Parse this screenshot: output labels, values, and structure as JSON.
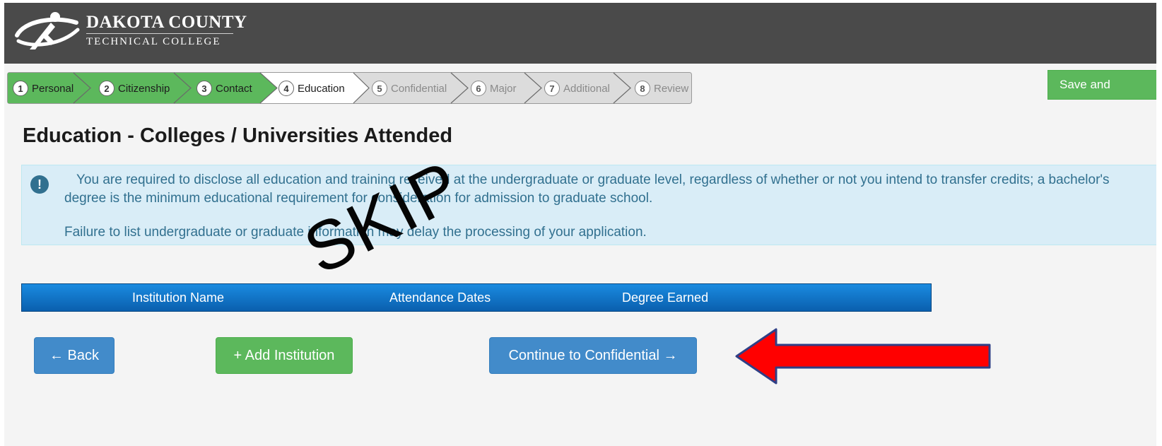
{
  "header": {
    "logo_line1": "DAKOTA COUNTY",
    "logo_line2": "TECHNICAL COLLEGE"
  },
  "steps": [
    {
      "num": "1",
      "label": "Personal",
      "state": "done"
    },
    {
      "num": "2",
      "label": "Citizenship",
      "state": "done"
    },
    {
      "num": "3",
      "label": "Contact",
      "state": "done"
    },
    {
      "num": "4",
      "label": "Education",
      "state": "current"
    },
    {
      "num": "5",
      "label": "Confidential",
      "state": "future"
    },
    {
      "num": "6",
      "label": "Major",
      "state": "future"
    },
    {
      "num": "7",
      "label": "Additional",
      "state": "future"
    },
    {
      "num": "8",
      "label": "Review",
      "state": "future"
    }
  ],
  "save_button": "Save and",
  "page_title": "Education - Colleges / Universities Attended",
  "alert": {
    "icon": "exclamation-circle-icon",
    "text1": "You are required to disclose all education and training received at the undergraduate or graduate level, regardless of whether or not you intend to transfer credits; a bachelor's degree is the minimum educational requirement for consideration for admission to graduate school.",
    "text2": "Failure to list undergraduate or graduate information may delay the processing of your application."
  },
  "table": {
    "columns": [
      "Institution Name",
      "Attendance Dates",
      "Degree Earned"
    ]
  },
  "buttons": {
    "back": "← Back",
    "add": "+ Add Institution",
    "continue": "Continue to Confidential →"
  },
  "annotation": {
    "text": "SKIP",
    "arrow_color": "#ff0000"
  },
  "colors": {
    "header_bg": "#4a4a4a",
    "step_done": "#5cb85c",
    "step_current": "#ffffff",
    "step_future": "#dcdcdc",
    "primary": "#428bca",
    "success": "#5cb85c",
    "alert_bg": "#d9edf7",
    "alert_text": "#31708f",
    "table_head": "#0a6fc2"
  }
}
